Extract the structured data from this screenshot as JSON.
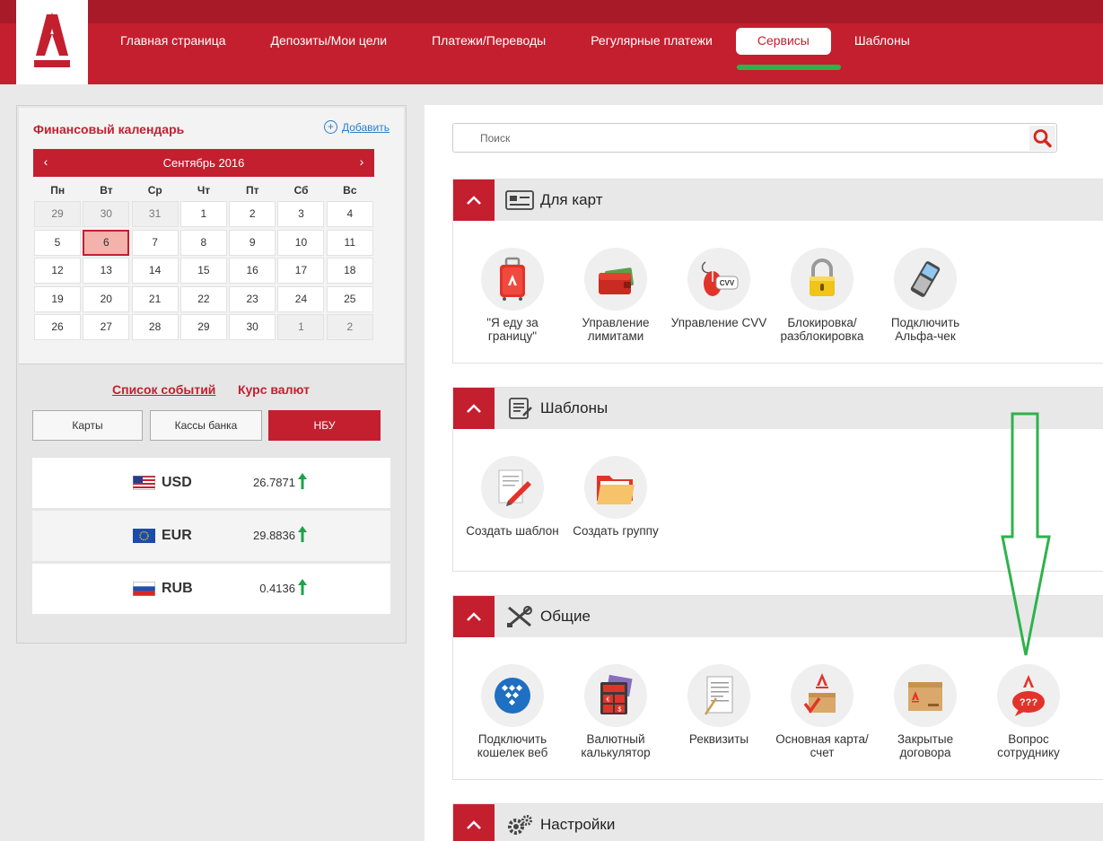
{
  "colors": {
    "brand": "#c41f2f",
    "accent_green": "#2fb24b",
    "up_arrow": "#1ea34a"
  },
  "nav": {
    "items": [
      {
        "label": "Главная страница"
      },
      {
        "label": "Депозиты/Мои цели"
      },
      {
        "label": "Платежи/Переводы"
      },
      {
        "label": "Регулярные платежи"
      },
      {
        "label": "Сервисы"
      },
      {
        "label": "Шаблоны"
      }
    ],
    "active": "Сервисы"
  },
  "calendar": {
    "title": "Финансовый календарь",
    "add_label": "Добавить",
    "month": "Сентябрь 2016",
    "prev_icon": "chevron-left-icon",
    "next_icon": "chevron-right-icon",
    "weekdays": [
      "Пн",
      "Вт",
      "Ср",
      "Чт",
      "Пт",
      "Сб",
      "Вс"
    ],
    "days": [
      "29",
      "30",
      "31",
      "1",
      "2",
      "3",
      "4",
      "5",
      "6",
      "7",
      "8",
      "9",
      "10",
      "11",
      "12",
      "13",
      "14",
      "15",
      "16",
      "17",
      "18",
      "19",
      "20",
      "21",
      "22",
      "23",
      "24",
      "25",
      "26",
      "27",
      "28",
      "29",
      "30",
      "1",
      "2"
    ],
    "other_month_indices": [
      0,
      1,
      2,
      33,
      34
    ],
    "today_index": 8
  },
  "rates": {
    "events_tab": "Список событий",
    "rates_tab": "Курс валют",
    "buttons": [
      "Карты",
      "Кассы банка",
      "НБУ"
    ],
    "active_button": "НБУ",
    "rows": [
      {
        "currency": "USD",
        "value": "26.7871",
        "trend": "up",
        "flag_icon": "us-flag-icon"
      },
      {
        "currency": "EUR",
        "value": "29.8836",
        "trend": "up",
        "flag_icon": "eu-flag-icon"
      },
      {
        "currency": "RUB",
        "value": "0.4136",
        "trend": "up",
        "flag_icon": "ru-flag-icon"
      }
    ]
  },
  "search": {
    "placeholder": "Поиск",
    "icon": "search-icon"
  },
  "sections": [
    {
      "title": "Для карт",
      "icon": "card-icon",
      "tiles": [
        {
          "label": "\"Я еду за границу\"",
          "icon": "suitcase-icon"
        },
        {
          "label": "Управление лимитами",
          "icon": "wallet-icon"
        },
        {
          "label": "Управление CVV",
          "icon": "cvv-mouse-icon"
        },
        {
          "label": "Блокировка/ разблокировка",
          "icon": "padlock-icon"
        },
        {
          "label": "Подключить Альфа-чек",
          "icon": "phone-icon"
        }
      ]
    },
    {
      "title": "Шаблоны",
      "icon": "template-icon",
      "tiles": [
        {
          "label": "Создать шаблон",
          "icon": "document-pencil-icon"
        },
        {
          "label": "Создать группу",
          "icon": "folder-icon"
        }
      ]
    },
    {
      "title": "Общие",
      "icon": "tools-icon",
      "tiles": [
        {
          "label": "Подключить кошелек веб",
          "icon": "webmoney-globe-icon"
        },
        {
          "label": "Валютный калькулятор",
          "icon": "calculator-icon"
        },
        {
          "label": "Реквизиты",
          "icon": "document-icon"
        },
        {
          "label": "Основная карта/счет",
          "icon": "box-check-icon"
        },
        {
          "label": "Закрытые договора",
          "icon": "closed-box-icon"
        },
        {
          "label": "Вопрос сотруднику",
          "icon": "question-bubble-icon"
        }
      ]
    },
    {
      "title": "Настройки",
      "icon": "gears-icon",
      "tiles": []
    }
  ]
}
